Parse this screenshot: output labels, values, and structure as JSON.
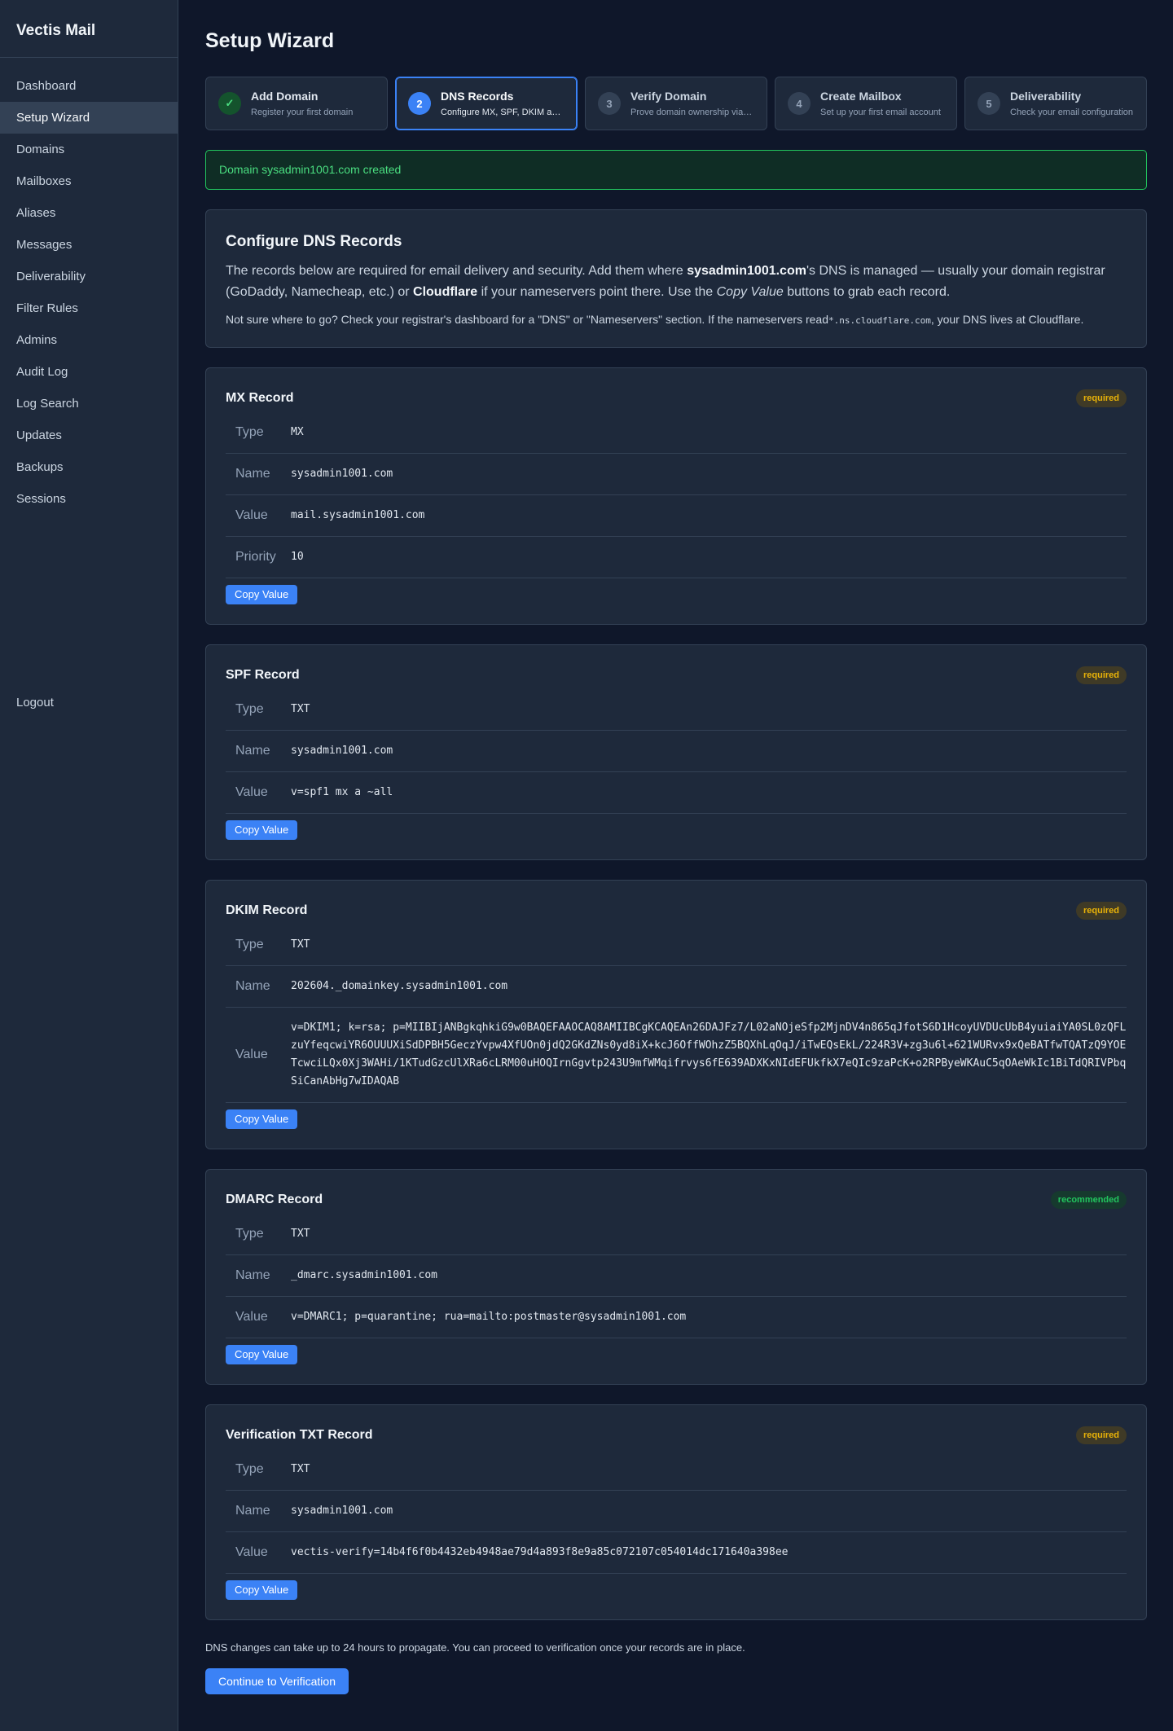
{
  "app": {
    "name": "Vectis Mail"
  },
  "sidebar": {
    "items": [
      {
        "label": "Dashboard"
      },
      {
        "label": "Setup Wizard"
      },
      {
        "label": "Domains"
      },
      {
        "label": "Mailboxes"
      },
      {
        "label": "Aliases"
      },
      {
        "label": "Messages"
      },
      {
        "label": "Deliverability"
      },
      {
        "label": "Filter Rules"
      },
      {
        "label": "Admins"
      },
      {
        "label": "Audit Log"
      },
      {
        "label": "Log Search"
      },
      {
        "label": "Updates"
      },
      {
        "label": "Backups"
      },
      {
        "label": "Sessions"
      }
    ],
    "active_index": 1,
    "logout": "Logout"
  },
  "page": {
    "title": "Setup Wizard"
  },
  "steps": [
    {
      "num": "✓",
      "title": "Add Domain",
      "sub": "Register your first domain",
      "state": "done"
    },
    {
      "num": "2",
      "title": "DNS Records",
      "sub": "Configure MX, SPF, DKIM and DMARC",
      "state": "current"
    },
    {
      "num": "3",
      "title": "Verify Domain",
      "sub": "Prove domain ownership via DNS",
      "state": "pending"
    },
    {
      "num": "4",
      "title": "Create Mailbox",
      "sub": "Set up your first email account",
      "state": "pending"
    },
    {
      "num": "5",
      "title": "Deliverability",
      "sub": "Check your email configuration",
      "state": "pending"
    }
  ],
  "alert": {
    "text": "Domain sysadmin1001.com created"
  },
  "intro": {
    "title": "Configure DNS Records",
    "p1_a": "The records below are required for email delivery and security. Add them where ",
    "p1_domain": "sysadmin1001.com",
    "p1_b": "'s DNS is managed — usually your domain registrar (GoDaddy, Namecheap, etc.) or ",
    "p1_cloudflare": "Cloudflare",
    "p1_c": " if your nameservers point there. Use the ",
    "p1_copy": "Copy Value",
    "p1_d": " buttons to grab each record.",
    "p2_a": "Not sure where to go? Check your registrar's dashboard for a \"DNS\" or \"Nameservers\" section. If the nameservers read",
    "p2_code": "*.ns.cloudflare.com",
    "p2_b": ", your DNS lives at Cloudflare."
  },
  "records": [
    {
      "title": "MX Record",
      "badge": "required",
      "rows": [
        {
          "label": "Type",
          "value": "MX"
        },
        {
          "label": "Name",
          "value": "sysadmin1001.com"
        },
        {
          "label": "Value",
          "value": "mail.sysadmin1001.com"
        },
        {
          "label": "Priority",
          "value": "10"
        }
      ],
      "copy_label": "Copy Value"
    },
    {
      "title": "SPF Record",
      "badge": "required",
      "rows": [
        {
          "label": "Type",
          "value": "TXT"
        },
        {
          "label": "Name",
          "value": "sysadmin1001.com"
        },
        {
          "label": "Value",
          "value": "v=spf1 mx a ~all"
        }
      ],
      "copy_label": "Copy Value"
    },
    {
      "title": "DKIM Record",
      "badge": "required",
      "rows": [
        {
          "label": "Type",
          "value": "TXT"
        },
        {
          "label": "Name",
          "value": "202604._domainkey.sysadmin1001.com"
        },
        {
          "label": "Value",
          "value": "v=DKIM1; k=rsa; p=MIIBIjANBgkqhkiG9w0BAQEFAAOCAQ8AMIIBCgKCAQEAn26DAJFz7/L02aNOjeSfp2MjnDV4n865qJfotS6D1HcoyUVDUcUbB4yuiaiYA0SL0zQFLzuYfeqcwiYR6OUUUXiSdDPBH5GeczYvpw4XfUOn0jdQ2GKdZNs0yd8iX+kcJ6OffWOhzZ5BQXhLqOqJ/iTwEQsEkL/224R3V+zg3u6l+621WURvx9xQeBATfwTQATzQ9YOETcwciLQx0Xj3WAHi/1KTudGzcUlXRa6cLRM00uHOQIrnGgvtp243U9mfWMqifrvys6fE639ADXKxNIdEFUkfkX7eQIc9zaPcK+o2RPByeWKAuC5qOAeWkIc1BiTdQRIVPbqSiCanAbHg7wIDAQAB"
        }
      ],
      "copy_label": "Copy Value"
    },
    {
      "title": "DMARC Record",
      "badge": "recommended",
      "rows": [
        {
          "label": "Type",
          "value": "TXT"
        },
        {
          "label": "Name",
          "value": "_dmarc.sysadmin1001.com"
        },
        {
          "label": "Value",
          "value": "v=DMARC1; p=quarantine; rua=mailto:postmaster@sysadmin1001.com"
        }
      ],
      "copy_label": "Copy Value"
    },
    {
      "title": "Verification TXT Record",
      "badge": "required",
      "rows": [
        {
          "label": "Type",
          "value": "TXT"
        },
        {
          "label": "Name",
          "value": "sysadmin1001.com"
        },
        {
          "label": "Value",
          "value": "vectis-verify=14b4f6f0b4432eb4948ae79d4a893f8e9a85c072107c054014dc171640a398ee"
        }
      ],
      "copy_label": "Copy Value"
    }
  ],
  "footer": {
    "note": "DNS changes can take up to 24 hours to propagate. You can proceed to verification once your records are in place.",
    "continue_label": "Continue to Verification"
  }
}
